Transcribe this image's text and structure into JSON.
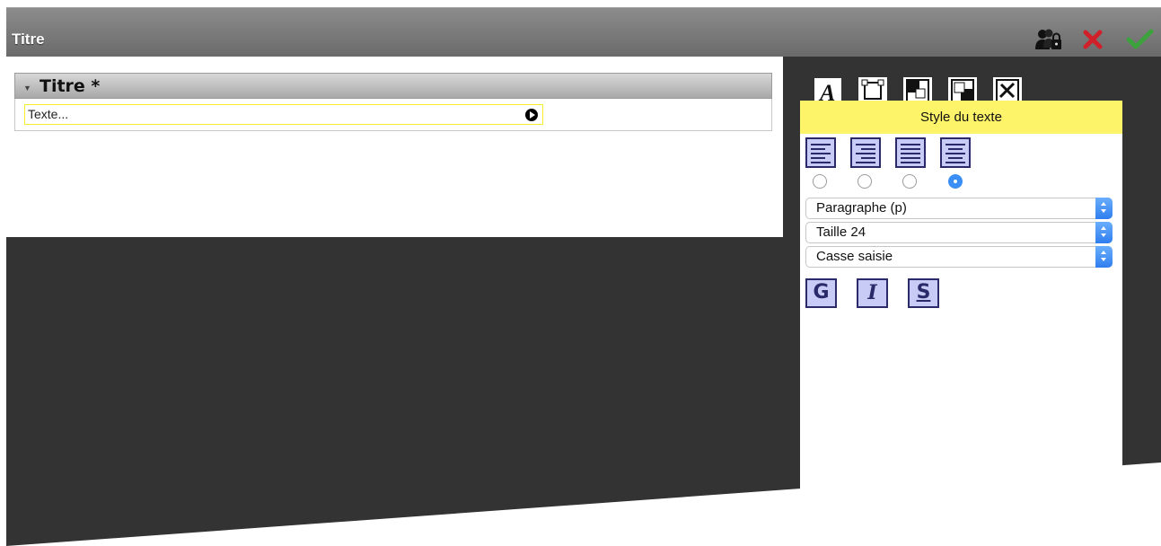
{
  "window": {
    "title": "Titre"
  },
  "toolbar": {
    "icons": [
      "users-lock-icon",
      "close-icon",
      "check-icon"
    ],
    "colors": {
      "close": "#d0202a",
      "ok": "#3ca33c"
    }
  },
  "editor": {
    "section_label": "Titre *",
    "text_field_value": "Texte..."
  },
  "panel": {
    "tabs": [
      "text-style-icon",
      "frame-icon",
      "shadow-icon",
      "shadow-alt-icon",
      "tools-icon"
    ],
    "header": "Style du texte",
    "alignments": [
      "align-left",
      "align-right",
      "align-justify",
      "align-center"
    ],
    "selected_alignment": 3,
    "selects": {
      "block": "Paragraphe (p)",
      "size": "Taille 24",
      "case": "Casse saisie"
    },
    "style_buttons": {
      "bold": "G",
      "italic": "I",
      "strike": "S"
    },
    "colors": {
      "header_bg": "#fdf46a",
      "button_bg": "#c8cbf5",
      "radio_checked": "#3a8ef6"
    }
  }
}
